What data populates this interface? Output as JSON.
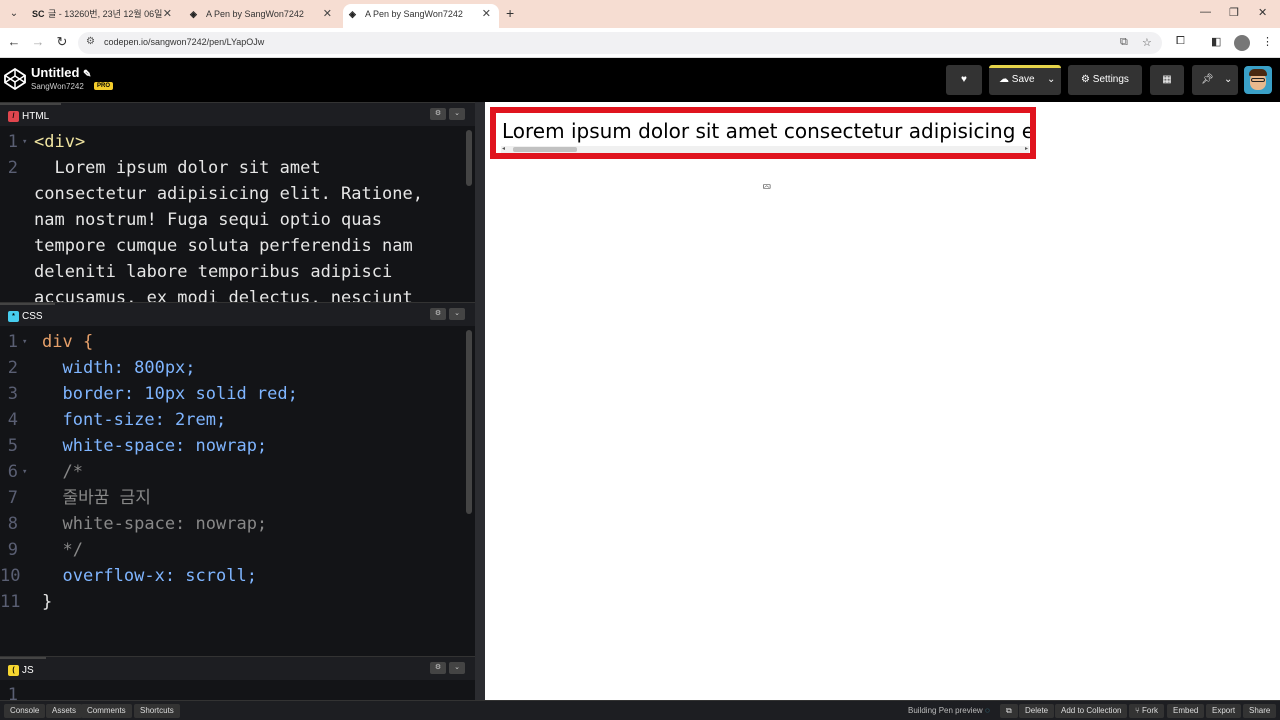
{
  "browser": {
    "tabs": [
      {
        "favicon": "SC",
        "title": "글 - 13260번, 23년 12월 06일"
      },
      {
        "favicon": "codepen-icon",
        "title": "A Pen by SangWon7242"
      },
      {
        "favicon": "codepen-icon",
        "title": "A Pen by SangWon7242"
      }
    ],
    "new_tab": "+",
    "url": "codepen.io/sangwon7242/pen/LYapOJw"
  },
  "header": {
    "pen_title": "Untitled",
    "edit_icon": "✎",
    "user": "SangWon7242",
    "badge": "PRO",
    "save_label": "Save",
    "settings_label": "Settings"
  },
  "panes": {
    "html": {
      "label": "HTML",
      "lines": [
        {
          "n": "1",
          "text": "<div>"
        },
        {
          "n": "2",
          "text": "  Lorem ipsum dolor sit amet"
        },
        {
          "n": "",
          "text": "consectetur adipisicing elit. Ratione,"
        },
        {
          "n": "",
          "text": "nam nostrum! Fuga sequi optio quas"
        },
        {
          "n": "",
          "text": "tempore cumque soluta perferendis nam"
        },
        {
          "n": "",
          "text": "deleniti labore temporibus adipisci"
        },
        {
          "n": "",
          "text": "accusamus, ex modi delectus, nesciunt"
        }
      ]
    },
    "css": {
      "label": "CSS",
      "lines": [
        {
          "n": "1",
          "text": "div {"
        },
        {
          "n": "2",
          "text": "  width: 800px;"
        },
        {
          "n": "3",
          "text": "  border: 10px solid red;"
        },
        {
          "n": "4",
          "text": "  font-size: 2rem;"
        },
        {
          "n": "5",
          "text": "  white-space: nowrap;"
        },
        {
          "n": "6",
          "text": "  /*"
        },
        {
          "n": "7",
          "text": "  줄바꿈 금지"
        },
        {
          "n": "8",
          "text": "  white-space: nowrap;"
        },
        {
          "n": "9",
          "text": "  */"
        },
        {
          "n": "10",
          "text": "  overflow-x: scroll;"
        },
        {
          "n": "11",
          "text": "}"
        }
      ]
    },
    "js": {
      "label": "JS",
      "lines": [
        {
          "n": "1",
          "text": ""
        }
      ]
    }
  },
  "preview": {
    "text": "Lorem ipsum dolor sit amet consectetur adipisicing elit"
  },
  "footer": {
    "left": [
      "Console",
      "Assets",
      "Comments",
      "Shortcuts"
    ],
    "status": "Building Pen preview",
    "right": [
      "Delete",
      "Add to Collection",
      "Fork",
      "Embed",
      "Export",
      "Share"
    ]
  },
  "colors": {
    "accent": "#e6d44a",
    "border_red": "#e0141e",
    "html_badge": "#e0464e",
    "css_badge": "#47cdef",
    "js_badge": "#f7d731"
  }
}
